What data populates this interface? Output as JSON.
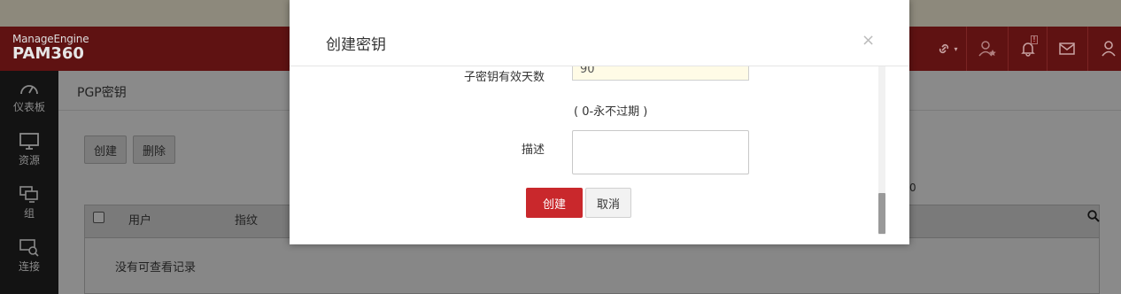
{
  "header": {
    "brand": "ManageEngine",
    "product": "PAM360",
    "icons": [
      "link-icon",
      "user-star-icon",
      "bell-alert-icon",
      "mail-icon",
      "user-icon"
    ],
    "alert_badge": "!"
  },
  "sidebar": {
    "items": [
      {
        "label": "仪表板",
        "icon": "dashboard-icon"
      },
      {
        "label": "资源",
        "icon": "monitor-icon"
      },
      {
        "label": "组",
        "icon": "group-icon"
      },
      {
        "label": "连接",
        "icon": "connection-icon"
      }
    ]
  },
  "page": {
    "title": "PGP密钥",
    "create_label": "创建",
    "delete_label": "删除",
    "columns": [
      "用户",
      "指纹"
    ],
    "empty_text": "没有可查看记录",
    "page_count": "0"
  },
  "modal": {
    "title": "创建密钥",
    "close_label": "×",
    "subkey_validity_label": "子密钥有效天数",
    "subkey_validity_value": "90",
    "subkey_hint": "( 0-永不过期 )",
    "description_label": "描述",
    "description_value": "",
    "create_button": "创建",
    "cancel_button": "取消"
  }
}
